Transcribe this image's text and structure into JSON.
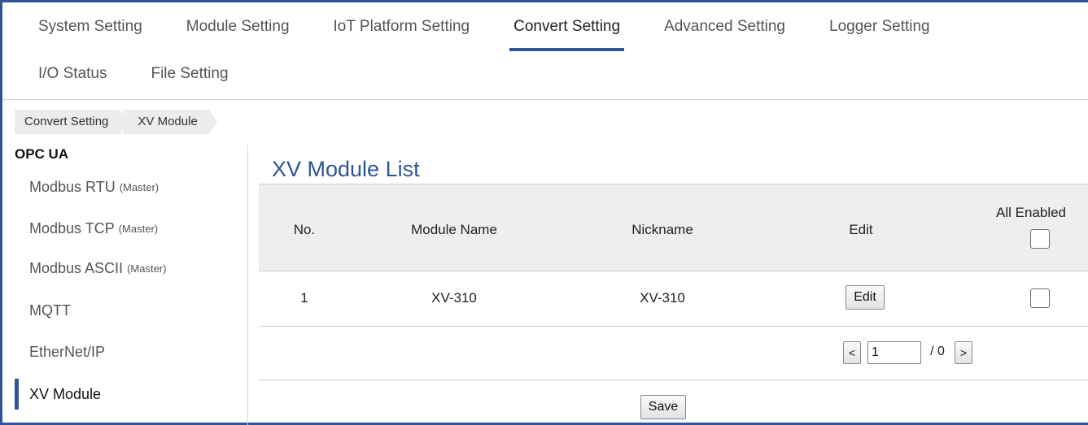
{
  "tabs_row1": [
    "System Setting",
    "Module Setting",
    "IoT Platform Setting",
    "Convert Setting",
    "Advanced Setting",
    "Logger Setting"
  ],
  "tabs_row2": [
    "I/O Status",
    "File Setting"
  ],
  "active_tab": "Convert Setting",
  "breadcrumb": [
    "Convert Setting",
    "XV Module"
  ],
  "sidebar": {
    "heading": "OPC UA",
    "items": [
      {
        "label": "Modbus RTU",
        "suffix": "(Master)"
      },
      {
        "label": "Modbus TCP",
        "suffix": "(Master)"
      },
      {
        "label": "Modbus ASCII",
        "suffix": "(Master)"
      },
      {
        "label": "MQTT",
        "suffix": ""
      },
      {
        "label": "EtherNet/IP",
        "suffix": ""
      },
      {
        "label": "XV Module",
        "suffix": ""
      }
    ]
  },
  "page_title": "XV Module List",
  "table": {
    "headers": {
      "no": "No.",
      "module_name": "Module Name",
      "nickname": "Nickname",
      "edit": "Edit",
      "all_enabled": "All Enabled"
    },
    "rows": [
      {
        "no": "1",
        "module_name": "XV-310",
        "nickname": "XV-310",
        "edit_label": "Edit",
        "enabled": false
      }
    ]
  },
  "pager": {
    "prev": "<",
    "page": "1",
    "total": "/ 0",
    "next": ">"
  },
  "save_label": "Save",
  "colors": {
    "accent": "#2f5597",
    "header_bg": "#eeeeee"
  }
}
